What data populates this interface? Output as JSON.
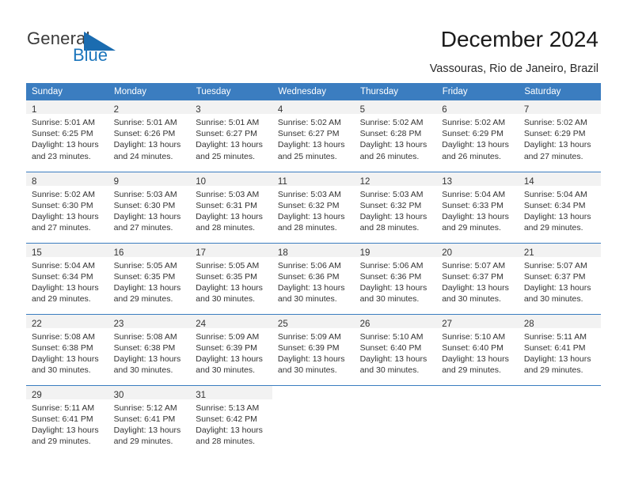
{
  "brand": {
    "word1": "General",
    "word2": "Blue",
    "accent_color": "#1b75bc",
    "triangle_icon": "triangle-icon"
  },
  "header": {
    "title": "December 2024",
    "subtitle": "Vassouras, Rio de Janeiro, Brazil"
  },
  "calendar": {
    "header_bg": "#3b7dc0",
    "daynum_bg": "#f2f2f2",
    "weekdays": [
      "Sunday",
      "Monday",
      "Tuesday",
      "Wednesday",
      "Thursday",
      "Friday",
      "Saturday"
    ],
    "weeks": [
      [
        {
          "day": "1",
          "sunrise": "Sunrise: 5:01 AM",
          "sunset": "Sunset: 6:25 PM",
          "daylight1": "Daylight: 13 hours",
          "daylight2": "and 23 minutes."
        },
        {
          "day": "2",
          "sunrise": "Sunrise: 5:01 AM",
          "sunset": "Sunset: 6:26 PM",
          "daylight1": "Daylight: 13 hours",
          "daylight2": "and 24 minutes."
        },
        {
          "day": "3",
          "sunrise": "Sunrise: 5:01 AM",
          "sunset": "Sunset: 6:27 PM",
          "daylight1": "Daylight: 13 hours",
          "daylight2": "and 25 minutes."
        },
        {
          "day": "4",
          "sunrise": "Sunrise: 5:02 AM",
          "sunset": "Sunset: 6:27 PM",
          "daylight1": "Daylight: 13 hours",
          "daylight2": "and 25 minutes."
        },
        {
          "day": "5",
          "sunrise": "Sunrise: 5:02 AM",
          "sunset": "Sunset: 6:28 PM",
          "daylight1": "Daylight: 13 hours",
          "daylight2": "and 26 minutes."
        },
        {
          "day": "6",
          "sunrise": "Sunrise: 5:02 AM",
          "sunset": "Sunset: 6:29 PM",
          "daylight1": "Daylight: 13 hours",
          "daylight2": "and 26 minutes."
        },
        {
          "day": "7",
          "sunrise": "Sunrise: 5:02 AM",
          "sunset": "Sunset: 6:29 PM",
          "daylight1": "Daylight: 13 hours",
          "daylight2": "and 27 minutes."
        }
      ],
      [
        {
          "day": "8",
          "sunrise": "Sunrise: 5:02 AM",
          "sunset": "Sunset: 6:30 PM",
          "daylight1": "Daylight: 13 hours",
          "daylight2": "and 27 minutes."
        },
        {
          "day": "9",
          "sunrise": "Sunrise: 5:03 AM",
          "sunset": "Sunset: 6:30 PM",
          "daylight1": "Daylight: 13 hours",
          "daylight2": "and 27 minutes."
        },
        {
          "day": "10",
          "sunrise": "Sunrise: 5:03 AM",
          "sunset": "Sunset: 6:31 PM",
          "daylight1": "Daylight: 13 hours",
          "daylight2": "and 28 minutes."
        },
        {
          "day": "11",
          "sunrise": "Sunrise: 5:03 AM",
          "sunset": "Sunset: 6:32 PM",
          "daylight1": "Daylight: 13 hours",
          "daylight2": "and 28 minutes."
        },
        {
          "day": "12",
          "sunrise": "Sunrise: 5:03 AM",
          "sunset": "Sunset: 6:32 PM",
          "daylight1": "Daylight: 13 hours",
          "daylight2": "and 28 minutes."
        },
        {
          "day": "13",
          "sunrise": "Sunrise: 5:04 AM",
          "sunset": "Sunset: 6:33 PM",
          "daylight1": "Daylight: 13 hours",
          "daylight2": "and 29 minutes."
        },
        {
          "day": "14",
          "sunrise": "Sunrise: 5:04 AM",
          "sunset": "Sunset: 6:34 PM",
          "daylight1": "Daylight: 13 hours",
          "daylight2": "and 29 minutes."
        }
      ],
      [
        {
          "day": "15",
          "sunrise": "Sunrise: 5:04 AM",
          "sunset": "Sunset: 6:34 PM",
          "daylight1": "Daylight: 13 hours",
          "daylight2": "and 29 minutes."
        },
        {
          "day": "16",
          "sunrise": "Sunrise: 5:05 AM",
          "sunset": "Sunset: 6:35 PM",
          "daylight1": "Daylight: 13 hours",
          "daylight2": "and 29 minutes."
        },
        {
          "day": "17",
          "sunrise": "Sunrise: 5:05 AM",
          "sunset": "Sunset: 6:35 PM",
          "daylight1": "Daylight: 13 hours",
          "daylight2": "and 30 minutes."
        },
        {
          "day": "18",
          "sunrise": "Sunrise: 5:06 AM",
          "sunset": "Sunset: 6:36 PM",
          "daylight1": "Daylight: 13 hours",
          "daylight2": "and 30 minutes."
        },
        {
          "day": "19",
          "sunrise": "Sunrise: 5:06 AM",
          "sunset": "Sunset: 6:36 PM",
          "daylight1": "Daylight: 13 hours",
          "daylight2": "and 30 minutes."
        },
        {
          "day": "20",
          "sunrise": "Sunrise: 5:07 AM",
          "sunset": "Sunset: 6:37 PM",
          "daylight1": "Daylight: 13 hours",
          "daylight2": "and 30 minutes."
        },
        {
          "day": "21",
          "sunrise": "Sunrise: 5:07 AM",
          "sunset": "Sunset: 6:37 PM",
          "daylight1": "Daylight: 13 hours",
          "daylight2": "and 30 minutes."
        }
      ],
      [
        {
          "day": "22",
          "sunrise": "Sunrise: 5:08 AM",
          "sunset": "Sunset: 6:38 PM",
          "daylight1": "Daylight: 13 hours",
          "daylight2": "and 30 minutes."
        },
        {
          "day": "23",
          "sunrise": "Sunrise: 5:08 AM",
          "sunset": "Sunset: 6:38 PM",
          "daylight1": "Daylight: 13 hours",
          "daylight2": "and 30 minutes."
        },
        {
          "day": "24",
          "sunrise": "Sunrise: 5:09 AM",
          "sunset": "Sunset: 6:39 PM",
          "daylight1": "Daylight: 13 hours",
          "daylight2": "and 30 minutes."
        },
        {
          "day": "25",
          "sunrise": "Sunrise: 5:09 AM",
          "sunset": "Sunset: 6:39 PM",
          "daylight1": "Daylight: 13 hours",
          "daylight2": "and 30 minutes."
        },
        {
          "day": "26",
          "sunrise": "Sunrise: 5:10 AM",
          "sunset": "Sunset: 6:40 PM",
          "daylight1": "Daylight: 13 hours",
          "daylight2": "and 30 minutes."
        },
        {
          "day": "27",
          "sunrise": "Sunrise: 5:10 AM",
          "sunset": "Sunset: 6:40 PM",
          "daylight1": "Daylight: 13 hours",
          "daylight2": "and 29 minutes."
        },
        {
          "day": "28",
          "sunrise": "Sunrise: 5:11 AM",
          "sunset": "Sunset: 6:41 PM",
          "daylight1": "Daylight: 13 hours",
          "daylight2": "and 29 minutes."
        }
      ],
      [
        {
          "day": "29",
          "sunrise": "Sunrise: 5:11 AM",
          "sunset": "Sunset: 6:41 PM",
          "daylight1": "Daylight: 13 hours",
          "daylight2": "and 29 minutes."
        },
        {
          "day": "30",
          "sunrise": "Sunrise: 5:12 AM",
          "sunset": "Sunset: 6:41 PM",
          "daylight1": "Daylight: 13 hours",
          "daylight2": "and 29 minutes."
        },
        {
          "day": "31",
          "sunrise": "Sunrise: 5:13 AM",
          "sunset": "Sunset: 6:42 PM",
          "daylight1": "Daylight: 13 hours",
          "daylight2": "and 28 minutes."
        },
        {
          "day": "",
          "sunrise": "",
          "sunset": "",
          "daylight1": "",
          "daylight2": ""
        },
        {
          "day": "",
          "sunrise": "",
          "sunset": "",
          "daylight1": "",
          "daylight2": ""
        },
        {
          "day": "",
          "sunrise": "",
          "sunset": "",
          "daylight1": "",
          "daylight2": ""
        },
        {
          "day": "",
          "sunrise": "",
          "sunset": "",
          "daylight1": "",
          "daylight2": ""
        }
      ]
    ]
  }
}
